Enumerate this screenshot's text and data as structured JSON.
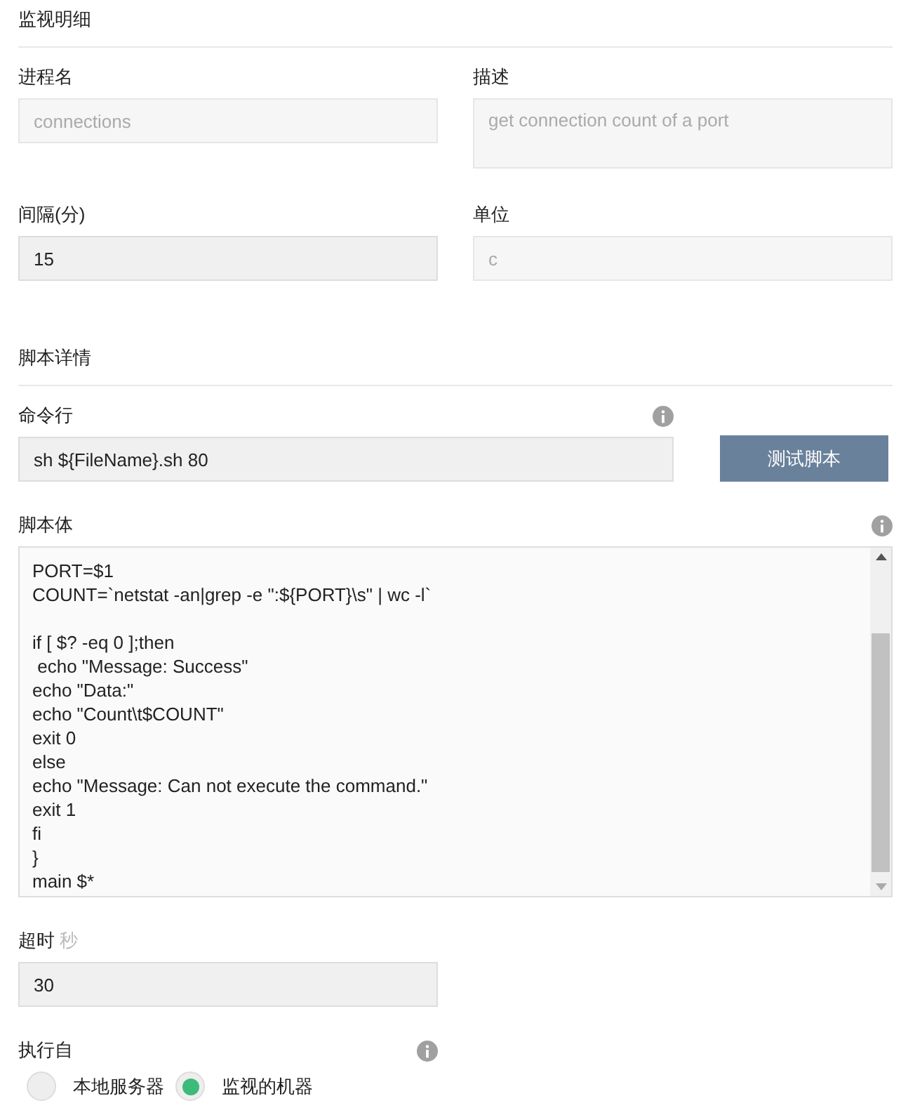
{
  "sections": [
    {
      "title": "监视明细",
      "fields": [
        {
          "label": "进程名",
          "value": "connections",
          "disabled": true,
          "kind": "input"
        },
        {
          "label": "描述",
          "value": "get connection count of a port",
          "disabled": true,
          "kind": "textarea"
        },
        {
          "label": "间隔(分)",
          "value": "15",
          "disabled": false,
          "kind": "input"
        },
        {
          "label": "单位",
          "value": "c",
          "disabled": true,
          "kind": "input"
        }
      ]
    },
    {
      "title": "脚本详情"
    }
  ],
  "command": {
    "label": "命令行",
    "value": "sh ${FileName}.sh 80",
    "button": "测试脚本"
  },
  "script": {
    "label": "脚本体",
    "lines": [
      {
        "lines": [
          "PORT=$1",
          "COUNT=`netstat -an|grep -e \":${PORT}\\s\" | wc -l`"
        ]
      },
      {
        "lines": [
          "if [ $? -eq 0 ];then",
          " echo \"Message: Success\"",
          "echo \"Data:\"",
          "echo \"Count\\t$COUNT\"",
          "exit 0",
          "else",
          "echo \"Message: Can not execute the command.\"",
          "exit 1",
          "fi",
          "}",
          "main $*"
        ]
      }
    ]
  },
  "timeout": {
    "label": "超时",
    "unit": "秒",
    "value": "30"
  },
  "execute": {
    "label": "执行自",
    "options": [
      {
        "label": "本地服务器",
        "selected": false
      },
      {
        "label": "监视的机器",
        "selected": true
      }
    ]
  }
}
